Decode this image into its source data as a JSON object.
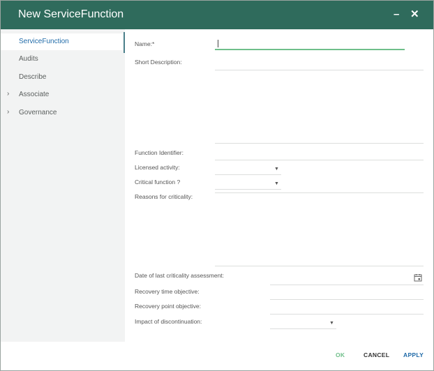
{
  "dialog": {
    "title": "New ServiceFunction",
    "minimize_glyph": "–",
    "close_glyph": "✕"
  },
  "sidebar": {
    "items": [
      {
        "label": "ServiceFunction",
        "active": true,
        "expandable": false
      },
      {
        "label": "Audits",
        "active": false,
        "expandable": false
      },
      {
        "label": "Describe",
        "active": false,
        "expandable": false
      },
      {
        "label": "Associate",
        "active": false,
        "expandable": true
      },
      {
        "label": "Governance",
        "active": false,
        "expandable": true
      }
    ],
    "chevron_glyph": "›"
  },
  "form": {
    "name_label": "Name:*",
    "name_value": "",
    "short_description_label": "Short Description:",
    "function_identifier_label": "Function Identifier:",
    "licensed_activity_label": "Licensed activity:",
    "critical_function_label": "Critical function ?",
    "reasons_label": "Reasons for criticality:",
    "date_assessment_label": "Date of last criticality assessment:",
    "recovery_time_label": "Recovery time objective:",
    "recovery_point_label": "Recovery point objective:",
    "impact_label": "Impact of discontinuation:",
    "dropdown_glyph": "▼"
  },
  "footer": {
    "ok_label": "OK",
    "cancel_label": "CANCEL",
    "apply_label": "APPLY"
  },
  "colors": {
    "titlebar": "#2f6b5c",
    "ok": "#6fbf8a",
    "cancel": "#333333",
    "apply": "#1f6aa8",
    "active_nav": "#1f6aa8"
  },
  "icons": {
    "calendar": "calendar-icon",
    "minimize": "minimize-icon",
    "close": "close-icon",
    "chevron": "chevron-right-icon",
    "dropdown": "dropdown-arrow-icon"
  }
}
